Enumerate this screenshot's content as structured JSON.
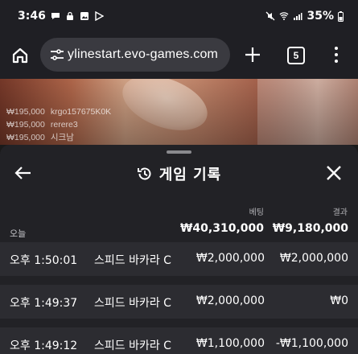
{
  "status_bar": {
    "time": "3:46",
    "battery": "35%"
  },
  "browser": {
    "url": "ylinestart.evo-games.com",
    "tab_count": "5"
  },
  "video": {
    "recent_bets": [
      {
        "amount": "₩195,000",
        "user": "krgo157675K0K"
      },
      {
        "amount": "₩195,000",
        "user": "rerere3"
      },
      {
        "amount": "₩195,000",
        "user": "시크남"
      }
    ]
  },
  "panel": {
    "title": "게임 기록",
    "col_bet": "베팅",
    "col_result": "결과",
    "today_label": "오늘",
    "today_bet_total": "₩40,310,000",
    "today_result_total": "₩9,180,000",
    "records": [
      {
        "time": "오후 1:50:01",
        "game": "스피드 바카라 C",
        "bet": "₩2,000,000",
        "result": "₩2,000,000"
      },
      {
        "time": "오후 1:49:37",
        "game": "스피드 바카라 C",
        "bet": "₩2,000,000",
        "result": "₩0"
      },
      {
        "time": "오후 1:49:12",
        "game": "스피드 바카라 C",
        "bet": "₩1,100,000",
        "result": "-₩1,100,000"
      }
    ]
  }
}
